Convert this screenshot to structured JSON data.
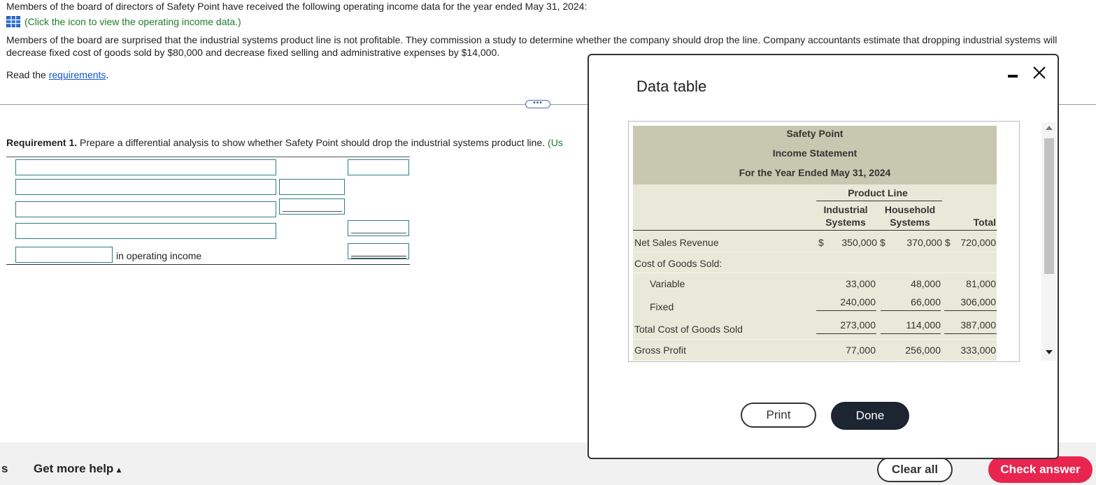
{
  "intro": "Members of the board of directors of Safety Point have received the following operating income data for the year ended May 31, 2024:",
  "click_link": "(Click the icon to view the operating income data.)",
  "paragraph": "Members of the board are surprised that the industrial systems product line is not profitable. They commission a study to determine whether the company should drop the line. Company accountants estimate that dropping industrial systems will decrease fixed cost of goods sold by $80,000 and decrease fixed selling and administrative expenses by $14,000.",
  "read_prefix": "Read the ",
  "read_link": "requirements",
  "read_suffix": ".",
  "requirement": {
    "label": "Requirement 1.",
    "text": " Prepare a differential analysis to show whether Safety Point should drop the industrial systems product line.",
    "hint": " (Us"
  },
  "in_operating_income": "in operating income",
  "footer": {
    "left_letter": "s",
    "help": "Get more help",
    "help_arrow": "▴",
    "clear_all": "Clear all",
    "check_answer": "Check answer"
  },
  "modal": {
    "title": "Data table",
    "minimize_icon": "minimize-icon",
    "close_icon": "close-icon",
    "print": "Print",
    "done": "Done",
    "table": {
      "company": "Safety Point",
      "statement": "Income Statement",
      "period": "For the Year Ended May 31, 2024",
      "group_header": "Product Line",
      "col1_line1": "Industrial",
      "col1_line2": "Systems",
      "col2_line1": "Household",
      "col2_line2": "Systems",
      "col3": "Total",
      "rows": [
        {
          "label": "Net Sales Revenue",
          "c1_sign": "$",
          "c1": "350,000",
          "c2_sign": "$",
          "c2": "370,000",
          "c3_sign": "$",
          "c3": "720,000"
        },
        {
          "label": "Cost of Goods Sold:",
          "c1_sign": "",
          "c1": "",
          "c2_sign": "",
          "c2": "",
          "c3_sign": "",
          "c3": ""
        },
        {
          "label": "Variable",
          "c1_sign": "",
          "c1": "33,000",
          "c2_sign": "",
          "c2": "48,000",
          "c3_sign": "",
          "c3": "81,000"
        },
        {
          "label": "Fixed",
          "c1_sign": "",
          "c1": "240,000",
          "c2_sign": "",
          "c2": "66,000",
          "c3_sign": "",
          "c3": "306,000"
        },
        {
          "label": "Total Cost of Goods Sold",
          "c1_sign": "",
          "c1": "273,000",
          "c2_sign": "",
          "c2": "114,000",
          "c3_sign": "",
          "c3": "387,000"
        },
        {
          "label": "Gross Profit",
          "c1_sign": "",
          "c1": "77,000",
          "c2_sign": "",
          "c2": "256,000",
          "c3_sign": "",
          "c3": "333,000"
        }
      ]
    }
  },
  "colors": {
    "link": "#1155cc",
    "hint_green": "#1e7b30",
    "check_answer_bg": "#e8244f",
    "done_bg": "#1c2531",
    "table_header_bg": "#c8c8b0",
    "table_body_bg": "#e9e9d9"
  }
}
